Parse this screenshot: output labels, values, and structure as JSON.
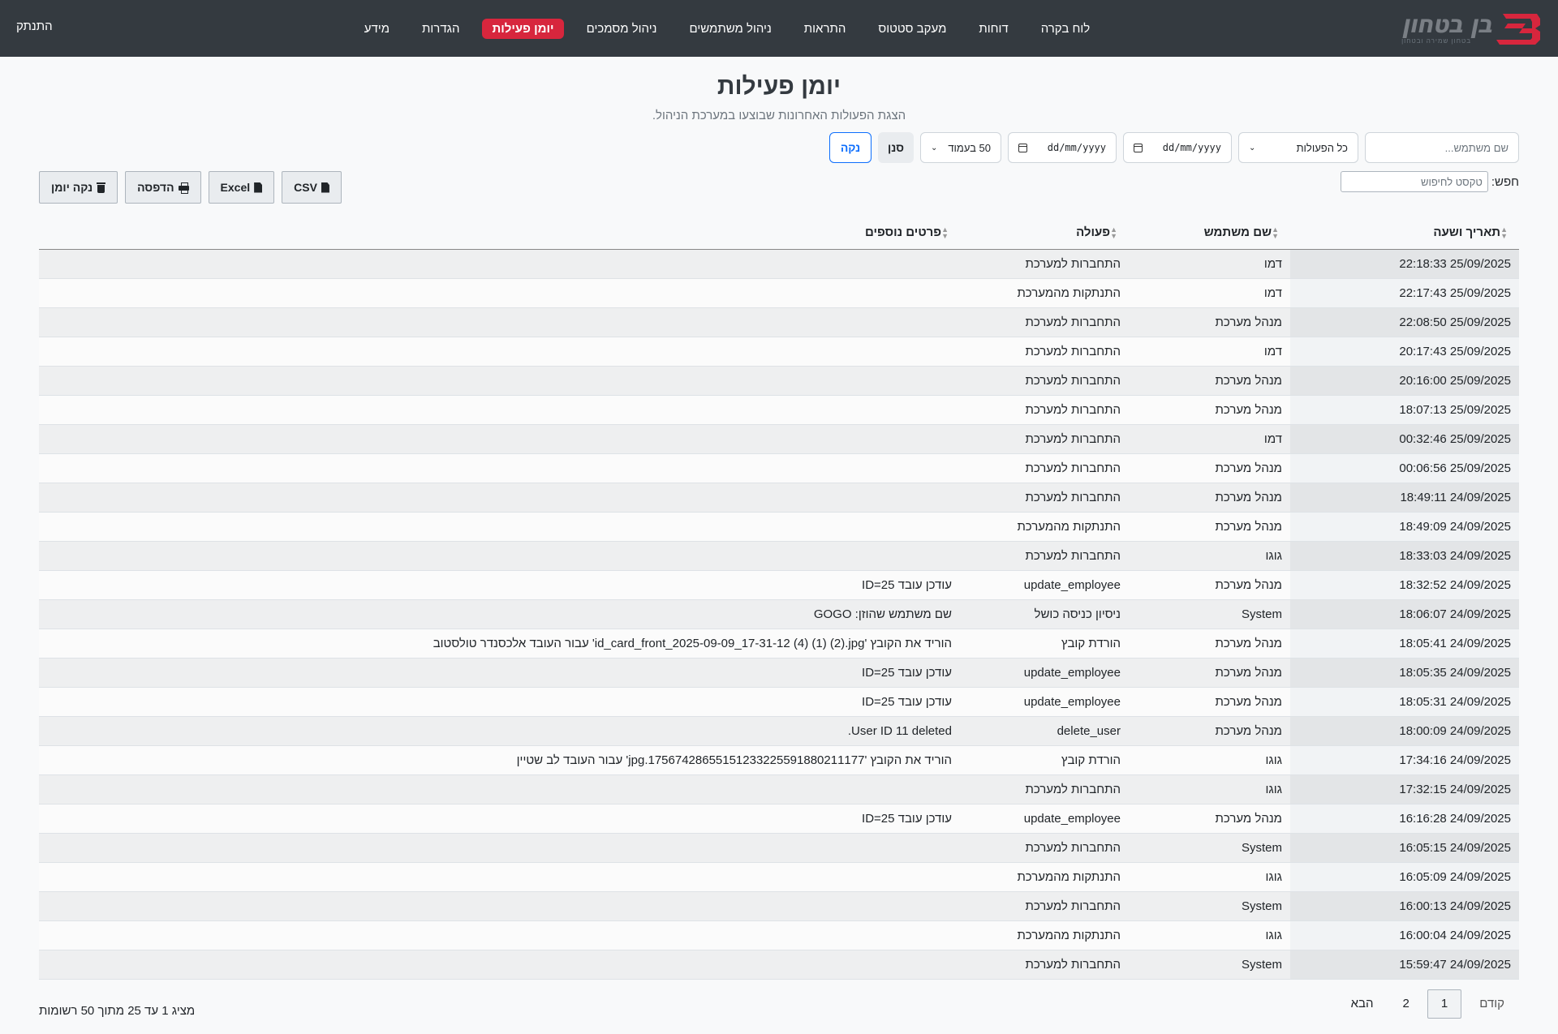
{
  "brand": {
    "name": "בן בטחון",
    "tagline": "בטחון שמירה ובטחון"
  },
  "nav": {
    "items": [
      {
        "label": "לוח בקרה",
        "active": false
      },
      {
        "label": "דוחות",
        "active": false
      },
      {
        "label": "מעקב סטטוס",
        "active": false
      },
      {
        "label": "התראות",
        "active": false
      },
      {
        "label": "ניהול משתמשים",
        "active": false
      },
      {
        "label": "ניהול מסמכים",
        "active": false
      },
      {
        "label": "יומן פעילות",
        "active": true
      },
      {
        "label": "הגדרות",
        "active": false
      },
      {
        "label": "מידע",
        "active": false
      }
    ],
    "logout": "התנתק"
  },
  "page": {
    "title": "יומן פעילות",
    "subtitle": "הצגת הפעולות האחרונות שבוצעו במערכת הניהול."
  },
  "filters": {
    "user_placeholder": "שם משתמש...",
    "action_select": "כל הפעולות",
    "date_from": "dd/mm/yyyy",
    "date_to": "dd/mm/yyyy",
    "per_page": "50 בעמוד",
    "filter_label": "סנן",
    "clear_label": "נקה"
  },
  "search": {
    "label": "חפש:",
    "placeholder": "טקסט לחיפוש"
  },
  "export": {
    "csv": "CSV",
    "excel": "Excel",
    "print": "הדפסה",
    "clear_log": "נקה יומן"
  },
  "table": {
    "headers": {
      "date": "תאריך ושעה",
      "user": "שם משתמש",
      "action": "פעולה",
      "details": "פרטים נוספים"
    },
    "rows": [
      {
        "date": "25/09/2025 22:18:33",
        "user": "דמו",
        "action": "התחברות למערכת",
        "details": ""
      },
      {
        "date": "25/09/2025 22:17:43",
        "user": "דמו",
        "action": "התנתקות מהמערכת",
        "details": ""
      },
      {
        "date": "25/09/2025 22:08:50",
        "user": "מנהל מערכת",
        "action": "התחברות למערכת",
        "details": ""
      },
      {
        "date": "25/09/2025 20:17:43",
        "user": "דמו",
        "action": "התחברות למערכת",
        "details": ""
      },
      {
        "date": "25/09/2025 20:16:00",
        "user": "מנהל מערכת",
        "action": "התחברות למערכת",
        "details": ""
      },
      {
        "date": "25/09/2025 18:07:13",
        "user": "מנהל מערכת",
        "action": "התחברות למערכת",
        "details": ""
      },
      {
        "date": "25/09/2025 00:32:46",
        "user": "דמו",
        "action": "התחברות למערכת",
        "details": ""
      },
      {
        "date": "25/09/2025 00:06:56",
        "user": "מנהל מערכת",
        "action": "התחברות למערכת",
        "details": ""
      },
      {
        "date": "24/09/2025 18:49:11",
        "user": "מנהל מערכת",
        "action": "התחברות למערכת",
        "details": ""
      },
      {
        "date": "24/09/2025 18:49:09",
        "user": "מנהל מערכת",
        "action": "התנתקות מהמערכת",
        "details": ""
      },
      {
        "date": "24/09/2025 18:33:03",
        "user": "גוגו",
        "action": "התחברות למערכת",
        "details": ""
      },
      {
        "date": "24/09/2025 18:32:52",
        "user": "מנהל מערכת",
        "action": "update_employee",
        "details": "עודכן עובד ID=25"
      },
      {
        "date": "24/09/2025 18:06:07",
        "user": "System",
        "action": "ניסיון כניסה כושל",
        "details": "שם משתמש שהוזן: GOGO"
      },
      {
        "date": "24/09/2025 18:05:41",
        "user": "מנהל מערכת",
        "action": "הורדת קובץ",
        "details": "הוריד את הקובץ 'id_card_front_2025-09-09_17-31-12 (4) (1) (2).jpg' עבור העובד אלכסנדר טולסטוב"
      },
      {
        "date": "24/09/2025 18:05:35",
        "user": "מנהל מערכת",
        "action": "update_employee",
        "details": "עודכן עובד ID=25"
      },
      {
        "date": "24/09/2025 18:05:31",
        "user": "מנהל מערכת",
        "action": "update_employee",
        "details": "עודכן עובד ID=25"
      },
      {
        "date": "24/09/2025 18:00:09",
        "user": "מנהל מערכת",
        "action": "delete_user",
        "details": "User ID 11 deleted."
      },
      {
        "date": "24/09/2025 17:34:16",
        "user": "גוגו",
        "action": "הורדת קובץ",
        "details": "הוריד את הקובץ '17567428655151233225591880211177.jpg' עבור העובד לב שטיין"
      },
      {
        "date": "24/09/2025 17:32:15",
        "user": "גוגו",
        "action": "התחברות למערכת",
        "details": ""
      },
      {
        "date": "24/09/2025 16:16:28",
        "user": "מנהל מערכת",
        "action": "update_employee",
        "details": "עודכן עובד ID=25"
      },
      {
        "date": "24/09/2025 16:05:15",
        "user": "System",
        "action": "התחברות למערכת",
        "details": ""
      },
      {
        "date": "24/09/2025 16:05:09",
        "user": "גוגו",
        "action": "התנתקות מהמערכת",
        "details": ""
      },
      {
        "date": "24/09/2025 16:00:13",
        "user": "System",
        "action": "התחברות למערכת",
        "details": ""
      },
      {
        "date": "24/09/2025 16:00:04",
        "user": "גוגו",
        "action": "התנתקות מהמערכת",
        "details": ""
      },
      {
        "date": "24/09/2025 15:59:47",
        "user": "System",
        "action": "התחברות למערכת",
        "details": ""
      }
    ]
  },
  "pagination": {
    "prev": "קודם",
    "pages": [
      "1",
      "2"
    ],
    "current": "1",
    "next": "הבא"
  },
  "footer": {
    "info": "מציג 1 עד 25 מתוך 50 רשומות"
  },
  "colors": {
    "navbar": "#343a40",
    "active_nav": "#d7263d",
    "brand_red": "#d7263d",
    "clear_btn": "#0d6efd"
  }
}
